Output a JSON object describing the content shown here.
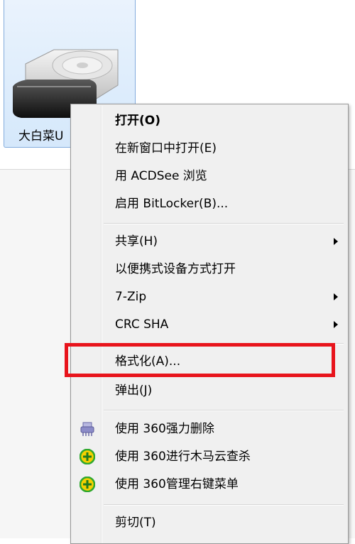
{
  "drive": {
    "label": "大白菜U"
  },
  "context_menu": {
    "items": [
      {
        "label": "打开(O)",
        "bold": true
      },
      {
        "label": "在新窗口中打开(E)"
      },
      {
        "label": "用 ACDSee 浏览"
      },
      {
        "label": "启用 BitLocker(B)..."
      },
      {
        "label": "共享(H)",
        "submenu": true
      },
      {
        "label": "以便携式设备方式打开"
      },
      {
        "label": "7-Zip",
        "submenu": true
      },
      {
        "label": "CRC SHA",
        "submenu": true
      },
      {
        "label": "格式化(A)..."
      },
      {
        "label": "弹出(J)"
      },
      {
        "label": "使用 360强力删除",
        "icon": "shredder-icon"
      },
      {
        "label": "使用 360进行木马云查杀",
        "icon": "360-shield-icon"
      },
      {
        "label": "使用 360管理右键菜单",
        "icon": "360-shield-icon"
      },
      {
        "label": "剪切(T)"
      }
    ]
  },
  "colors": {
    "highlight": "#e8141c",
    "selection": "#d5e8fb",
    "menu_bg": "#f0f0f0",
    "icon_360_green": "#2fa82f",
    "icon_360_yellow": "#f5d000",
    "shredder_purple": "#8c8cc8"
  }
}
